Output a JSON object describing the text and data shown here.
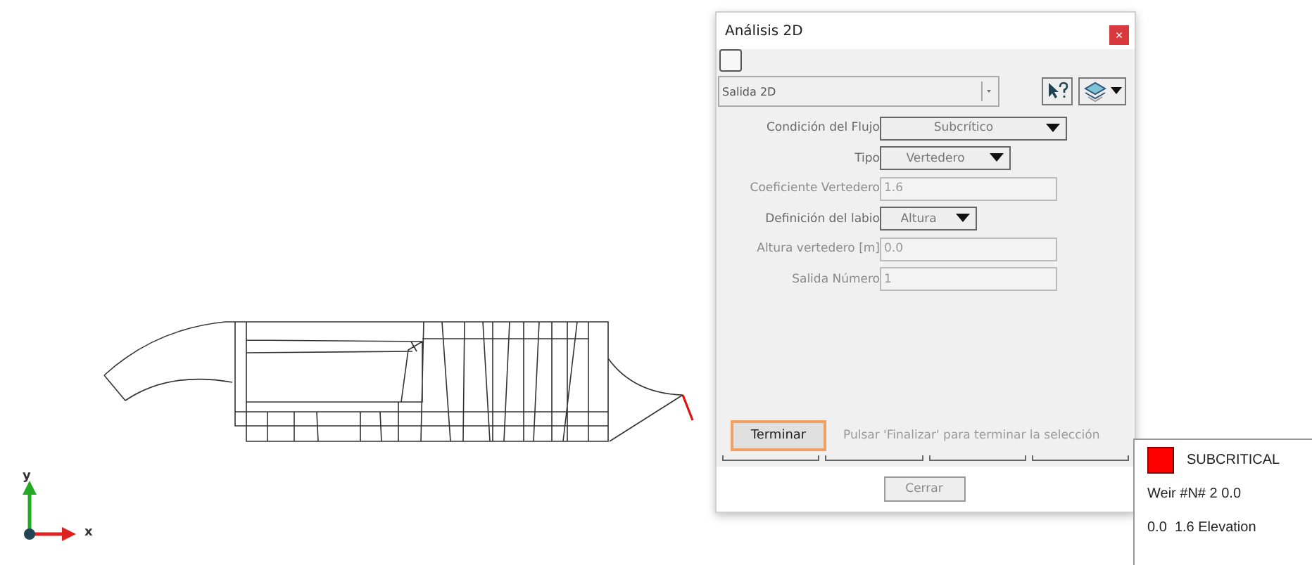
{
  "dialog": {
    "title": "Análisis 2D",
    "close_label": "×",
    "selector": {
      "value": "Salida 2D"
    },
    "fields": [
      {
        "kind": "dropdown",
        "label": "Condición del Flujo",
        "value": "Subcrítico",
        "disabled": false
      },
      {
        "kind": "dropdown",
        "label": "Tipo",
        "value": "Vertedero",
        "disabled": false
      },
      {
        "kind": "text",
        "label": "Coeficiente Vertedero",
        "value": "1.6",
        "disabled": true
      },
      {
        "kind": "dropdown",
        "label": "Definición del labio",
        "value": "Altura",
        "disabled": false
      },
      {
        "kind": "text",
        "label": "Altura vertedero [m]",
        "value": "0.0",
        "disabled": true
      },
      {
        "kind": "text",
        "label": "Salida Número",
        "value": "1",
        "disabled": true
      }
    ],
    "finish_button": "Terminar",
    "hint": "Pulsar 'Finalizar' para terminar la selección",
    "close_button": "Cerrar"
  },
  "legend": {
    "items": [
      {
        "kind": "swatch",
        "label": "SUBCRITICAL",
        "color": "#ff0000"
      },
      {
        "kind": "text",
        "label": "Weir #N# 2 0.0"
      },
      {
        "kind": "text",
        "label": "0.0  1.6 Elevation"
      }
    ]
  },
  "axes": {
    "x": "x",
    "y": "y"
  }
}
